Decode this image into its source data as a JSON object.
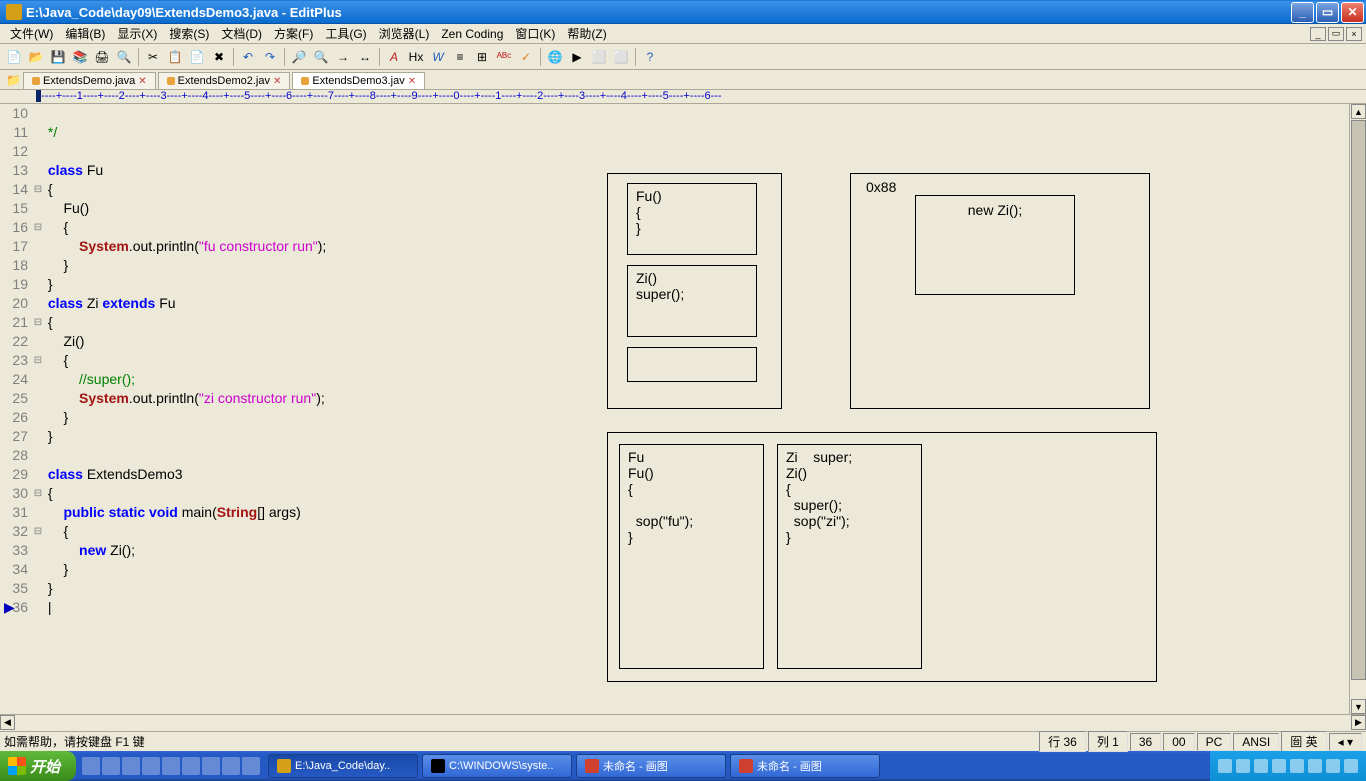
{
  "title": "E:\\Java_Code\\day09\\ExtendsDemo3.java - EditPlus",
  "menu": {
    "file": "文件(W)",
    "edit": "编辑(B)",
    "view": "显示(X)",
    "search": "搜索(S)",
    "document": "文档(D)",
    "project": "方案(F)",
    "tool": "工具(G)",
    "browser": "浏览器(L)",
    "zen": "Zen Coding",
    "window": "窗口(K)",
    "help": "帮助(Z)"
  },
  "tabs": [
    {
      "label": "ExtendsDemo.java",
      "active": false
    },
    {
      "label": "ExtendsDemo2.jav",
      "active": false
    },
    {
      "label": "ExtendsDemo3.jav",
      "active": true
    }
  ],
  "ruler": "----+----1----+----2----+----3----+----4----+----5----+----6----+----7----+----8----+----9----+----0----+----1----+----2----+----3----+----4----+----5----+----6---",
  "code": {
    "lines": [
      {
        "n": 10,
        "fold": "",
        "html": ""
      },
      {
        "n": 11,
        "fold": "",
        "html": " <span class='cmt'>*/</span>"
      },
      {
        "n": 12,
        "fold": "",
        "html": ""
      },
      {
        "n": 13,
        "fold": "",
        "html": " <span class='kw'>class</span> Fu"
      },
      {
        "n": 14,
        "fold": "⊟",
        "html": " {"
      },
      {
        "n": 15,
        "fold": "",
        "html": "     Fu()"
      },
      {
        "n": 16,
        "fold": "⊟",
        "html": "     {"
      },
      {
        "n": 17,
        "fold": "",
        "html": "         <span class='sys'>System</span>.out.println(<span class='str'>\"fu constructor run\"</span>);"
      },
      {
        "n": 18,
        "fold": "",
        "html": "     }"
      },
      {
        "n": 19,
        "fold": "",
        "html": " }"
      },
      {
        "n": 20,
        "fold": "",
        "html": " <span class='kw'>class</span> Zi <span class='kw'>extends</span> Fu"
      },
      {
        "n": 21,
        "fold": "⊟",
        "html": " {"
      },
      {
        "n": 22,
        "fold": "",
        "html": "     Zi()"
      },
      {
        "n": 23,
        "fold": "⊟",
        "html": "     {"
      },
      {
        "n": 24,
        "fold": "",
        "html": "         <span class='cmt'>//super();</span>"
      },
      {
        "n": 25,
        "fold": "",
        "html": "         <span class='sys'>System</span>.out.println(<span class='str'>\"zi constructor run\"</span>);"
      },
      {
        "n": 26,
        "fold": "",
        "html": "     }"
      },
      {
        "n": 27,
        "fold": "",
        "html": " }"
      },
      {
        "n": 28,
        "fold": "",
        "html": ""
      },
      {
        "n": 29,
        "fold": "",
        "html": " <span class='kw'>class</span> ExtendsDemo3"
      },
      {
        "n": 30,
        "fold": "⊟",
        "html": " {"
      },
      {
        "n": 31,
        "fold": "",
        "html": "     <span class='kw'>public</span> <span class='kw'>static</span> <span class='kw'>void</span> main(<span class='sys'>String</span>[] args)"
      },
      {
        "n": 32,
        "fold": "⊟",
        "html": "     {"
      },
      {
        "n": 33,
        "fold": "",
        "html": "         <span class='kw'>new</span> Zi();"
      },
      {
        "n": 34,
        "fold": "",
        "html": "     }"
      },
      {
        "n": 35,
        "fold": "",
        "html": " }"
      },
      {
        "n": 36,
        "fold": "",
        "html": " |",
        "current": true
      }
    ]
  },
  "diagram": {
    "top_left": {
      "fu": "Fu()\n{\n}",
      "zi": "Zi()\nsuper();"
    },
    "top_right": {
      "addr": "0x88",
      "newzi": "new Zi();"
    },
    "bottom": {
      "fu": "Fu\nFu()\n{\n\n  sop(\"fu\");\n}",
      "zi": "Zi    super;\nZi()\n{\n  super();\n  sop(\"zi\");\n}"
    }
  },
  "status": {
    "help": "如需帮助，请按键盘 F1 键",
    "line_lbl": "行",
    "line": "36",
    "col_lbl": "列",
    "col": "1",
    "total": "36",
    "sel": "00",
    "mode": "PC",
    "enc": "ANSI",
    "ime": "囼 英"
  },
  "taskbar": {
    "start": "开始",
    "tasks": [
      {
        "label": "E:\\Java_Code\\day..",
        "active": true
      },
      {
        "label": "C:\\WINDOWS\\syste..",
        "active": false
      },
      {
        "label": "未命名 - 画图",
        "active": false
      },
      {
        "label": "未命名 - 画图",
        "active": false
      }
    ]
  }
}
